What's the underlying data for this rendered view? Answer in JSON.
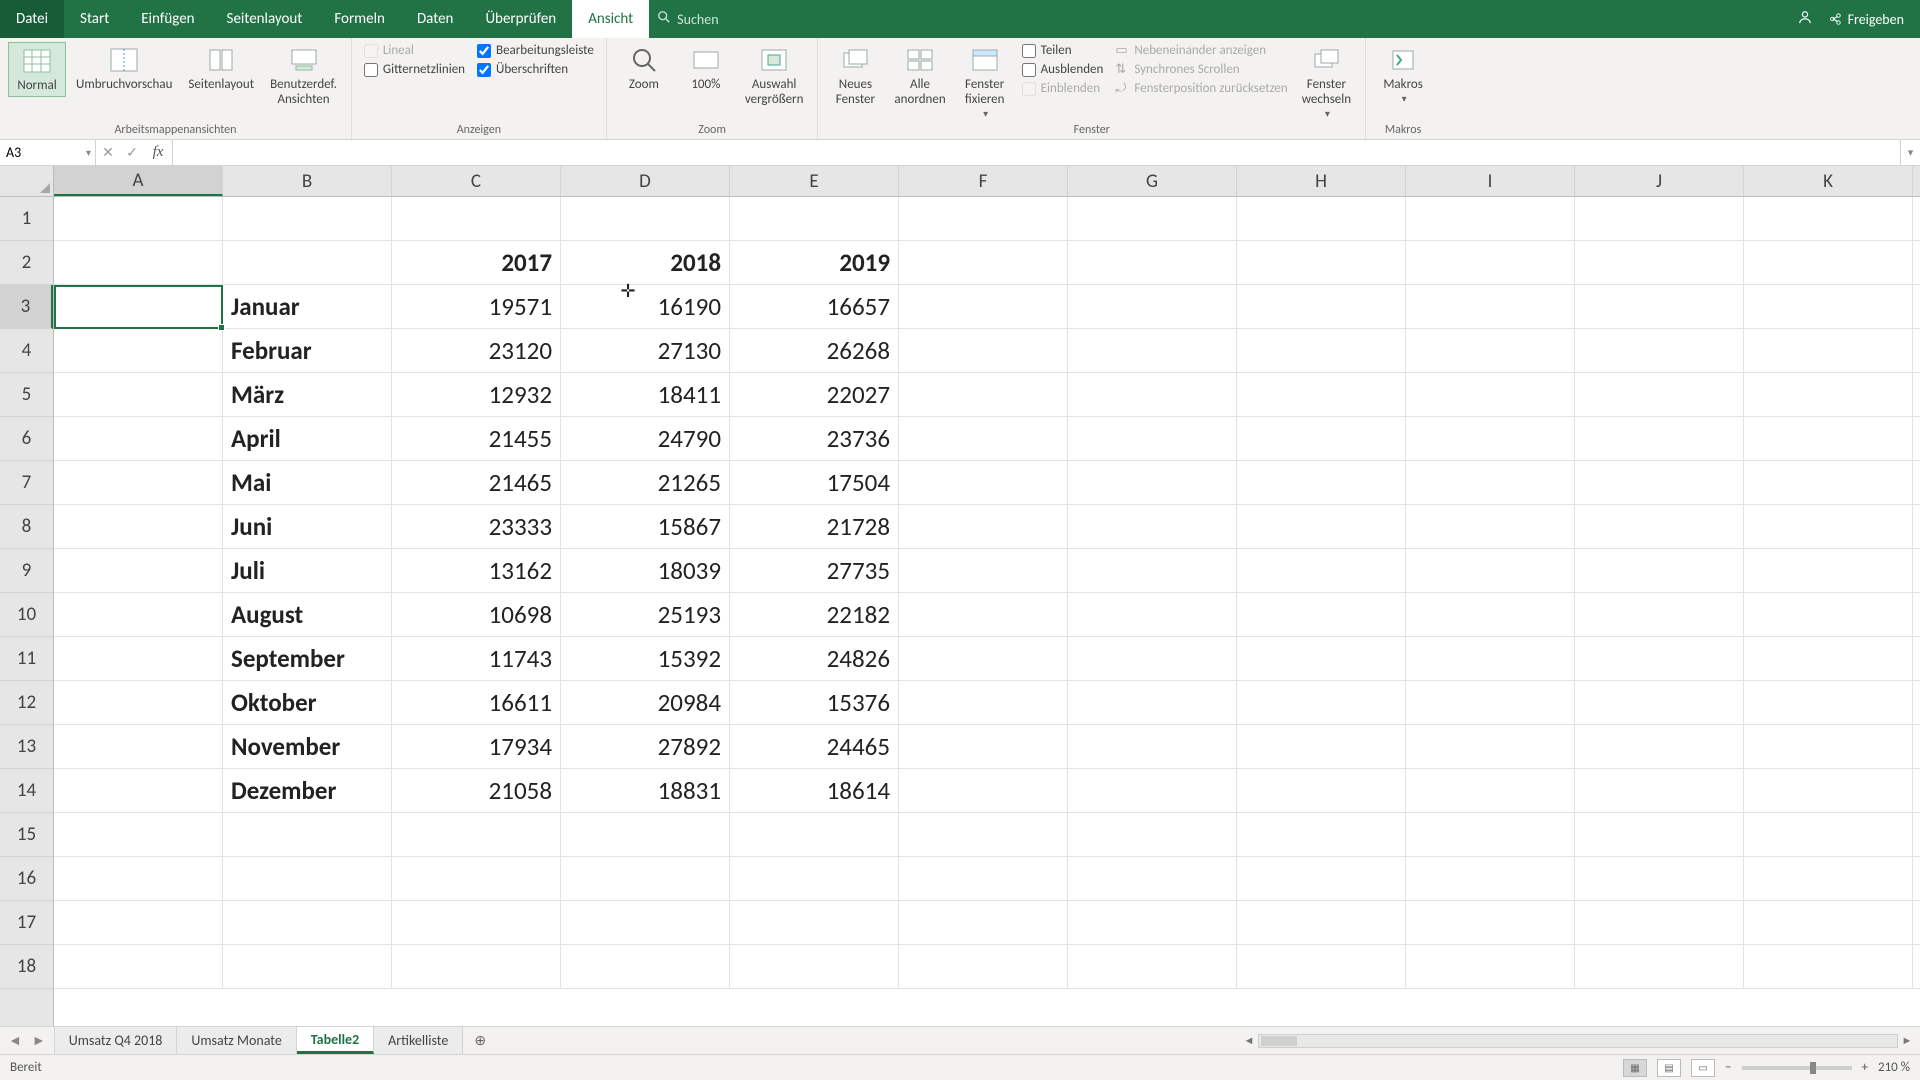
{
  "menu": {
    "file": "Datei",
    "start": "Start",
    "insert": "Einfügen",
    "layout": "Seitenlayout",
    "formulas": "Formeln",
    "data": "Daten",
    "review": "Überprüfen",
    "view": "Ansicht",
    "search": "Suchen"
  },
  "title_right": {
    "share": "Freigeben"
  },
  "ribbon": {
    "groups": {
      "views": {
        "label": "Arbeitsmappenansichten",
        "normal": "Normal",
        "break": "Umbruchvorschau",
        "page": "Seitenlayout",
        "custom1": "Benutzerdef.",
        "custom2": "Ansichten"
      },
      "show": {
        "label": "Anzeigen",
        "ruler": "Lineal",
        "formula_bar": "Bearbeitungsleiste",
        "gridlines": "Gitternetzlinien",
        "headings": "Überschriften"
      },
      "zoom": {
        "label": "Zoom",
        "zoom": "Zoom",
        "hundred": "100%",
        "selzoom1": "Auswahl",
        "selzoom2": "vergrößern"
      },
      "window": {
        "label": "Fenster",
        "new1": "Neues",
        "new2": "Fenster",
        "all1": "Alle",
        "all2": "anordnen",
        "freeze1": "Fenster",
        "freeze2": "fixieren",
        "split": "Teilen",
        "hide": "Ausblenden",
        "unhide": "Einblenden",
        "side": "Nebeneinander anzeigen",
        "sync": "Synchrones Scrollen",
        "reset": "Fensterposition zurücksetzen",
        "switch1": "Fenster",
        "switch2": "wechseln"
      },
      "macros": {
        "label": "Makros",
        "macros": "Makros"
      }
    }
  },
  "namebox": "A3",
  "formula": "",
  "columns": [
    "A",
    "B",
    "C",
    "D",
    "E",
    "F",
    "G",
    "H",
    "I",
    "J",
    "K"
  ],
  "row_numbers": [
    1,
    2,
    3,
    4,
    5,
    6,
    7,
    8,
    9,
    10,
    11,
    12,
    13,
    14,
    15,
    16,
    17,
    18
  ],
  "selected_cell": "A3",
  "chart_data": {
    "type": "table",
    "title": "",
    "columns": [
      "",
      "2017",
      "2018",
      "2019"
    ],
    "rows": [
      {
        "label": "Januar",
        "values": [
          19571,
          16190,
          16657
        ]
      },
      {
        "label": "Februar",
        "values": [
          23120,
          27130,
          26268
        ]
      },
      {
        "label": "März",
        "values": [
          12932,
          18411,
          22027
        ]
      },
      {
        "label": "April",
        "values": [
          21455,
          24790,
          23736
        ]
      },
      {
        "label": "Mai",
        "values": [
          21465,
          21265,
          17504
        ]
      },
      {
        "label": "Juni",
        "values": [
          23333,
          15867,
          21728
        ]
      },
      {
        "label": "Juli",
        "values": [
          13162,
          18039,
          27735
        ]
      },
      {
        "label": "August",
        "values": [
          10698,
          25193,
          22182
        ]
      },
      {
        "label": "September",
        "values": [
          11743,
          15392,
          24826
        ]
      },
      {
        "label": "Oktober",
        "values": [
          16611,
          20984,
          15376
        ]
      },
      {
        "label": "November",
        "values": [
          17934,
          27892,
          24465
        ]
      },
      {
        "label": "Dezember",
        "values": [
          21058,
          18831,
          18614
        ]
      }
    ]
  },
  "sheets": {
    "tabs": [
      "Umsatz Q4 2018",
      "Umsatz Monate",
      "Tabelle2",
      "Artikelliste"
    ],
    "active": 2
  },
  "status": {
    "ready": "Bereit",
    "zoom": "210 %"
  }
}
